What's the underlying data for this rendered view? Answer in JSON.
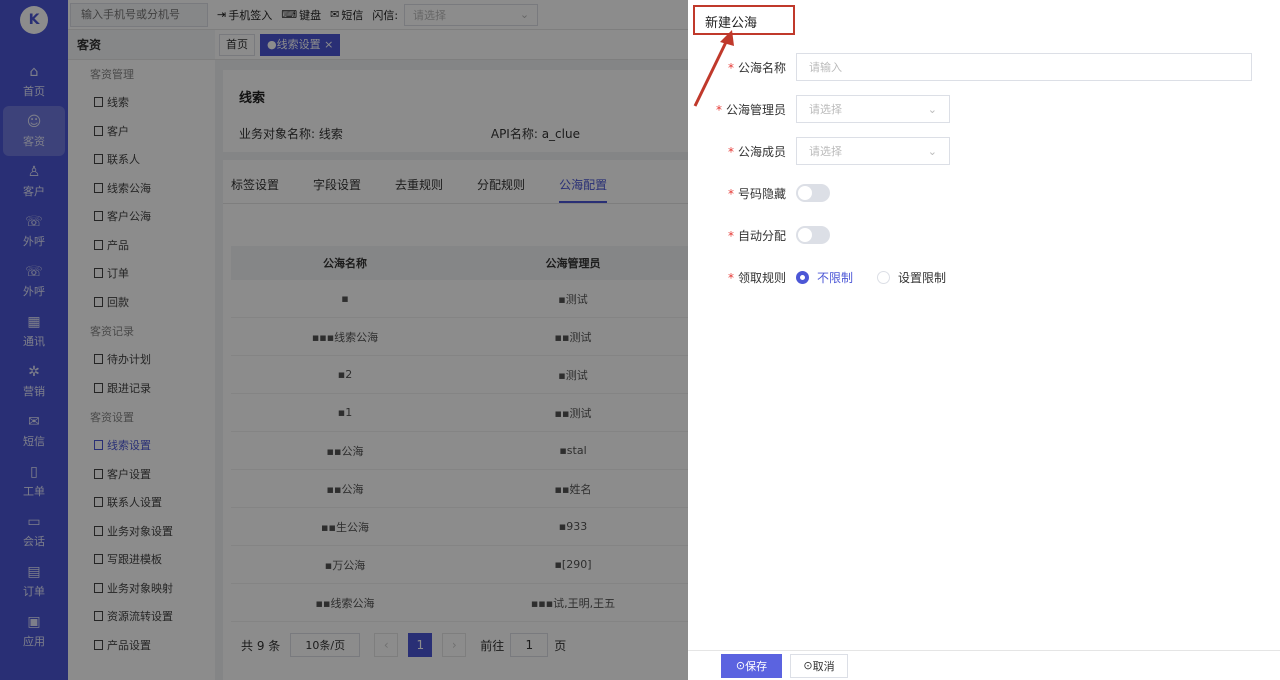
{
  "rail": {
    "items": [
      {
        "label": "首页",
        "icon": "home-icon"
      },
      {
        "label": "客资",
        "icon": "users-icon"
      },
      {
        "label": "客户",
        "icon": "customer-icon"
      },
      {
        "label": "外呼",
        "icon": "phone-out-icon"
      },
      {
        "label": "外呼",
        "icon": "phone-in-icon"
      },
      {
        "label": "通讯",
        "icon": "contacts-icon"
      },
      {
        "label": "营销",
        "icon": "marketing-icon"
      },
      {
        "label": "短信",
        "icon": "sms-icon"
      },
      {
        "label": "工单",
        "icon": "clipboard-icon"
      },
      {
        "label": "会话",
        "icon": "chat-icon"
      },
      {
        "label": "订单",
        "icon": "order-icon"
      },
      {
        "label": "应用",
        "icon": "app-icon"
      }
    ]
  },
  "topbar": {
    "phone_placeholder": "输入手机号或分机号",
    "signin": "手机签入",
    "keyboard": "键盘",
    "sms": "短信",
    "flash_label": "闪信:",
    "flash_placeholder": "请选择"
  },
  "secnav": {
    "title": "客资",
    "g1": "客资管理",
    "i1": "线索",
    "i2": "客户",
    "i3": "联系人",
    "i4": "线索公海",
    "i5": "客户公海",
    "i6": "产品",
    "i7": "订单",
    "i8": "回款",
    "g2": "客资记录",
    "i9": "待办计划",
    "i10": "跟进记录",
    "g3": "客资设置",
    "i11": "线索设置",
    "i12": "客户设置",
    "i13": "联系人设置",
    "i14": "业务对象设置",
    "i15": "写跟进模板",
    "i16": "业务对象映射",
    "i17": "资源流转设置",
    "i18": "产品设置"
  },
  "main": {
    "crumb_home": "首页",
    "crumb_active": "●线索设置 ×",
    "card_title": "线索",
    "obj_name": "业务对象名称: 线索",
    "api_name": "API名称: a_clue",
    "tabs": [
      "标签设置",
      "字段设置",
      "去重规则",
      "分配规则",
      "公海配置"
    ],
    "table": {
      "headers": [
        "公海名称",
        "公海管理员"
      ],
      "rows": [
        [
          "▪",
          "▪测试"
        ],
        [
          "▪▪▪线索公海",
          "▪▪测试"
        ],
        [
          "▪2",
          "▪测试"
        ],
        [
          "▪1",
          "▪▪测试"
        ],
        [
          "▪▪公海",
          "▪stal"
        ],
        [
          "▪▪公海",
          "▪▪姓名"
        ],
        [
          "▪▪生公海",
          "▪933"
        ],
        [
          "▪万公海",
          "▪[290]"
        ],
        [
          "▪▪线索公海",
          "▪▪▪试,王明,王五"
        ]
      ]
    },
    "pager": {
      "total": "共 9 条",
      "size": "10条/页",
      "page": "1",
      "goto": "前往",
      "goto_val": "1",
      "page_unit": "页"
    }
  },
  "drawer": {
    "title": "新建公海",
    "fields": {
      "name_label": "公海名称",
      "name_placeholder": "请输入",
      "admin_label": "公海管理员",
      "admin_placeholder": "请选择",
      "member_label": "公海成员",
      "member_placeholder": "请选择",
      "hide_label": "号码隐藏",
      "auto_label": "自动分配",
      "rule_label": "领取规则",
      "rule_opt1": "不限制",
      "rule_opt2": "设置限制"
    },
    "save": "保存",
    "cancel": "取消"
  },
  "colors": {
    "accent": "#4c57d6",
    "highlight": "#c0392b"
  }
}
